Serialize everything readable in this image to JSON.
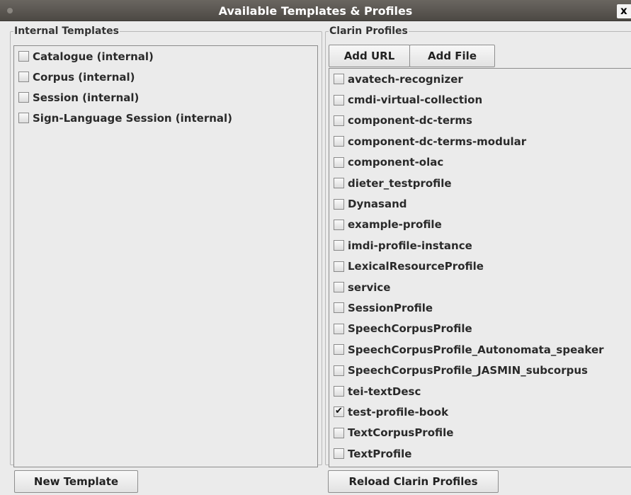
{
  "window": {
    "title": "Available Templates & Profiles",
    "close_glyph": "x"
  },
  "internal": {
    "legend": "Internal Templates",
    "items": [
      {
        "label": "Catalogue (internal)",
        "checked": false
      },
      {
        "label": "Corpus (internal)",
        "checked": false
      },
      {
        "label": "Session (internal)",
        "checked": false
      },
      {
        "label": "Sign-Language Session (internal)",
        "checked": false
      }
    ],
    "new_template_label": "New Template"
  },
  "clarin": {
    "legend": "Clarin Profiles",
    "add_url_label": "Add URL",
    "add_file_label": "Add File",
    "items": [
      {
        "label": "avatech-recognizer",
        "checked": false
      },
      {
        "label": "cmdi-virtual-collection",
        "checked": false
      },
      {
        "label": "component-dc-terms",
        "checked": false
      },
      {
        "label": "component-dc-terms-modular",
        "checked": false
      },
      {
        "label": "component-olac",
        "checked": false
      },
      {
        "label": "dieter_testprofile",
        "checked": false
      },
      {
        "label": "Dynasand",
        "checked": false
      },
      {
        "label": "example-profile",
        "checked": false
      },
      {
        "label": "imdi-profile-instance",
        "checked": false
      },
      {
        "label": "LexicalResourceProfile",
        "checked": false
      },
      {
        "label": "service",
        "checked": false
      },
      {
        "label": "SessionProfile",
        "checked": false
      },
      {
        "label": "SpeechCorpusProfile",
        "checked": false
      },
      {
        "label": "SpeechCorpusProfile_Autonomata_speaker",
        "checked": false
      },
      {
        "label": "SpeechCorpusProfile_JASMIN_subcorpus",
        "checked": false
      },
      {
        "label": "tei-textDesc",
        "checked": false
      },
      {
        "label": "test-profile-book",
        "checked": true
      },
      {
        "label": "TextCorpusProfile",
        "checked": false
      },
      {
        "label": "TextProfile",
        "checked": false
      }
    ],
    "reload_label": "Reload Clarin Profiles"
  }
}
